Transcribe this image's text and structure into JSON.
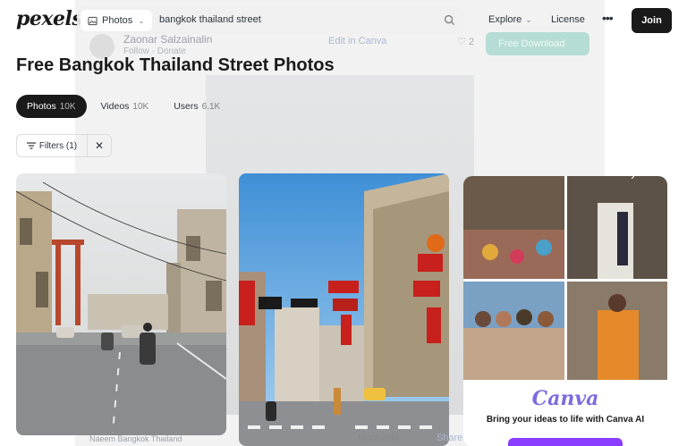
{
  "header": {
    "logo": "pexels",
    "search_type": "Photos",
    "search_query": "bangkok thailand street",
    "nav_explore": "Explore",
    "nav_license": "License",
    "join_label": "Join"
  },
  "page": {
    "title": "Free Bangkok Thailand Street Photos"
  },
  "tabs": [
    {
      "label": "Photos",
      "count": "10K",
      "active": true
    },
    {
      "label": "Videos",
      "count": "10K",
      "active": false
    },
    {
      "label": "Users",
      "count": "6.1K",
      "active": false
    }
  ],
  "filters": {
    "label": "Filters (1)",
    "clear": "✕"
  },
  "cards": {
    "card1_caption": "Naeem Bangkok Thailand"
  },
  "ad": {
    "logo": "Canva",
    "text": "Bring your ideas to life with Canva AI"
  },
  "ghost_modal": {
    "author": "Zaonar Salzainalin",
    "follow": "Follow · Donate",
    "edit": "Edit in Canva",
    "likes": "2",
    "download": "Free Download",
    "more_info": "More info",
    "share": "Share"
  },
  "colors": {
    "brand_dark": "#1a1a1a",
    "download_green": "#05a081",
    "canva_purple": "#7d6be0"
  }
}
